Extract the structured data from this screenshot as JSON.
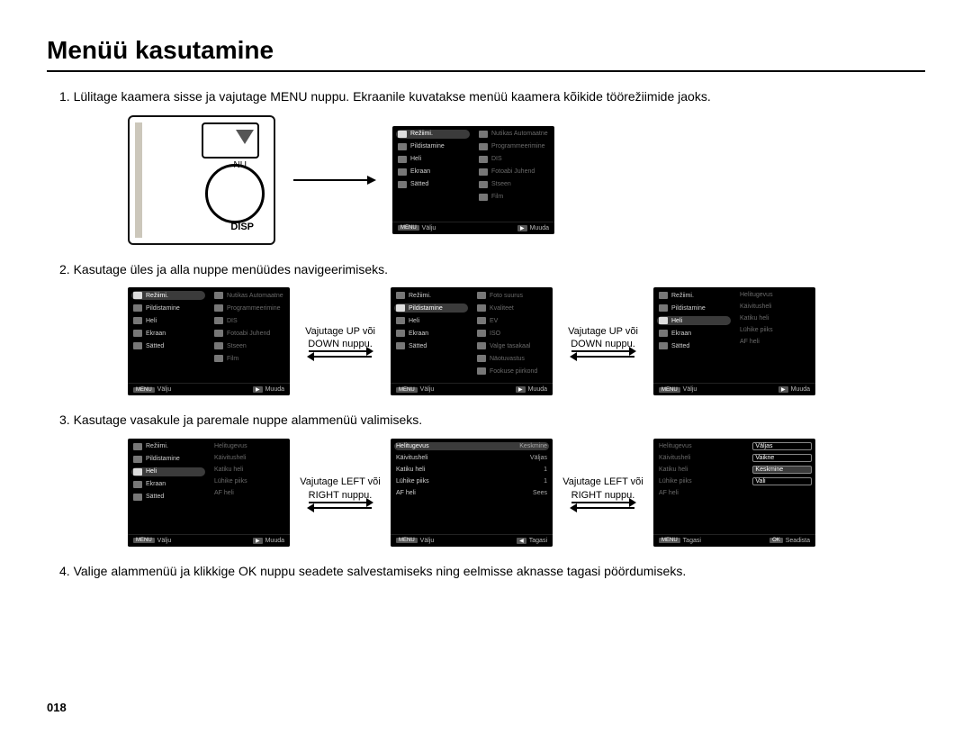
{
  "title": "Menüü kasutamine",
  "page_number": "018",
  "steps": {
    "s1": "1. Lülitage kaamera sisse ja vajutage MENU nuppu. Ekraanile kuvatakse menüü kaamera kõikide töörežiimide jaoks.",
    "s2": "2. Kasutage üles ja alla nuppe menüüdes navigeerimiseks.",
    "s3": "3. Kasutage vasakule ja paremale nuppe alammenüü valimiseks.",
    "s4": "4. Valige alammenüü ja klikkige OK nuppu seadete salvestamiseks ning eelmisse aknasse tagasi pöördumiseks."
  },
  "instr": {
    "ud": "Vajutage UP või DOWN nuppu.",
    "lr": "Vajutage LEFT või RIGHT nuppu."
  },
  "cam": {
    "label_nu": "NU",
    "label_disp": "DISP"
  },
  "footer": {
    "menu": "MENU",
    "exit": "Välju",
    "change": "Muuda",
    "back": "Tagasi",
    "set": "Seadista",
    "ok": "OK"
  },
  "menuA": {
    "left": [
      "Režiimi.",
      "Pildistamine",
      "Heli",
      "Ekraan",
      "Sätted"
    ],
    "right": [
      "Nutikas Automaatne",
      "Programmeerimine",
      "DIS",
      "Fotoabi Juhend",
      "Stseen",
      "Film"
    ]
  },
  "menuB": {
    "left": [
      "Režiimi.",
      "Pildistamine",
      "Heli",
      "Ekraan",
      "Sätted"
    ],
    "right": [
      "Foto suurus",
      "Kvaliteet",
      "EV",
      "ISO",
      "Valge tasakaal",
      "Näotuvastus",
      "Fookuse piirkond"
    ]
  },
  "menuC": {
    "left": [
      "Režiimi.",
      "Pildistamine",
      "Heli",
      "Ekraan",
      "Sätted"
    ],
    "right": [
      "Helitugevus",
      "Käivitusheli",
      "Katiku heli",
      "Lühike piiks",
      "AF heli"
    ]
  },
  "menuD": {
    "left": [
      "Helitugevus",
      "Käivitusheli",
      "Katiku heli",
      "Lühike piiks",
      "AF heli"
    ],
    "vals": [
      "Keskmine",
      "Väljas",
      "1",
      "1",
      "Sees"
    ]
  },
  "menuE": {
    "left": [
      "Helitugevus",
      "Käivitusheli",
      "Katiku heli",
      "Lühike piiks",
      "AF heli"
    ],
    "opts": [
      "Väljas",
      "Vaikne",
      "Keskmine",
      "Vali"
    ]
  }
}
